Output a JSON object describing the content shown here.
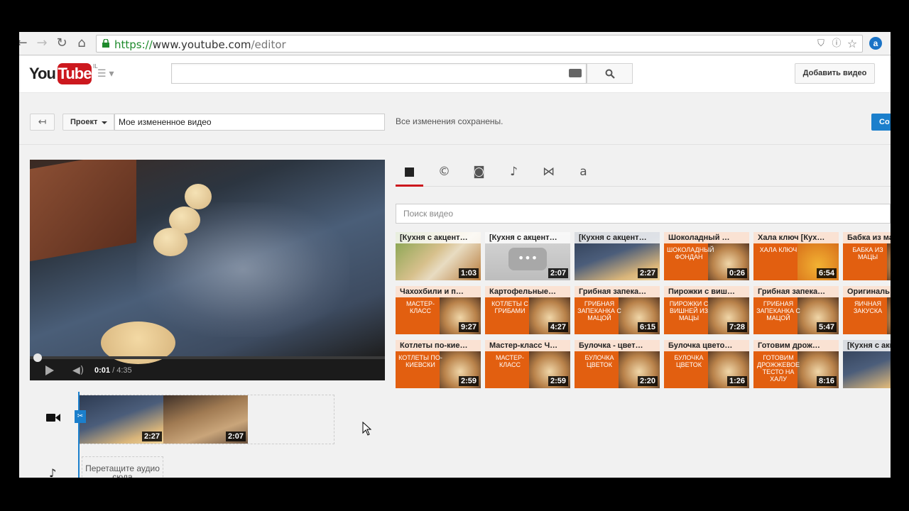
{
  "browser": {
    "url_scheme": "https://",
    "url_host": "www.youtube.com",
    "url_path": "/editor",
    "ext_label": "a"
  },
  "header": {
    "logo_you": "You",
    "logo_tube": "Tube",
    "logo_region": "IL",
    "search_placeholder": "",
    "upload_label": "Добавить видео"
  },
  "project": {
    "back_label": "↤",
    "menu_label": "Проект",
    "title_value": "Мое измененное видео",
    "saved_status": "Все изменения сохранены.",
    "publish_label": "Со"
  },
  "player": {
    "current_time": "0:01",
    "total_time": " / 4:35",
    "progress_fraction": 0.004
  },
  "library": {
    "search_placeholder": "Поиск видео",
    "tabs": [
      {
        "name": "video-camera-icon",
        "glyph": "■"
      },
      {
        "name": "cc-icon",
        "glyph": "©"
      },
      {
        "name": "camera-icon",
        "glyph": "◙"
      },
      {
        "name": "music-icon",
        "glyph": "♪"
      },
      {
        "name": "transition-icon",
        "glyph": "⋈"
      },
      {
        "name": "text-icon",
        "glyph": "a"
      }
    ],
    "videos": [
      {
        "title": "[Кухня с акцент…",
        "duration": "1:03",
        "style": "photo1",
        "brand": ""
      },
      {
        "title": "[Кухня с акцент…",
        "duration": "2:07",
        "style": "grey",
        "brand": ""
      },
      {
        "title": "[Кухня с акцент…",
        "duration": "2:27",
        "style": "photo2",
        "brand": ""
      },
      {
        "title": "Шоколадный …",
        "duration": "0:26",
        "style": "orange",
        "brand": "шоколадный фондан"
      },
      {
        "title": "Хала ключ [Кух…",
        "duration": "6:54",
        "style": "orange2",
        "brand": "хала ключ"
      },
      {
        "title": "Бабка из ма…",
        "duration": "",
        "style": "orange",
        "brand": "бабка из мацы"
      },
      {
        "title": "Чахохбили и п…",
        "duration": "9:27",
        "style": "orange",
        "brand": "мастер-класс"
      },
      {
        "title": "Картофельные…",
        "duration": "4:27",
        "style": "orange",
        "brand": "котлеты с грибами"
      },
      {
        "title": "Грибная запека…",
        "duration": "6:15",
        "style": "orange",
        "brand": "грибная запеканка с мацой"
      },
      {
        "title": "Пирожки с виш…",
        "duration": "7:28",
        "style": "orange",
        "brand": "пирожки с вишней из мацы"
      },
      {
        "title": "Грибная запека…",
        "duration": "5:47",
        "style": "orange",
        "brand": "грибная запеканка с мацой"
      },
      {
        "title": "Оригиналь…",
        "duration": "",
        "style": "orange",
        "brand": "яичная закуска"
      },
      {
        "title": "Котлеты по-кие…",
        "duration": "2:59",
        "style": "orange",
        "brand": "котлеты по-киевски"
      },
      {
        "title": "Мастер-класс Ч…",
        "duration": "2:59",
        "style": "orange",
        "brand": "мастер-класс"
      },
      {
        "title": "Булочка - цвет…",
        "duration": "2:20",
        "style": "orange",
        "brand": "булочка цветок"
      },
      {
        "title": "Булочка цвето…",
        "duration": "1:26",
        "style": "orange",
        "brand": "булочка цветок"
      },
      {
        "title": "Готовим дрож…",
        "duration": "8:16",
        "style": "orange",
        "brand": "готовим дрожжевое тесто на халу"
      },
      {
        "title": "[Кухня с акц…",
        "duration": "",
        "style": "photo2",
        "brand": ""
      }
    ]
  },
  "timeline": {
    "clips": [
      {
        "duration": "2:27",
        "style": "photo2"
      },
      {
        "duration": "2:07",
        "style": "buns"
      }
    ],
    "audio_drop_label": "Перетащите аудио сюда"
  },
  "colors": {
    "brand_red": "#cc181e",
    "accent_blue": "#1b7fcc",
    "thumb_orange": "#e25f10"
  }
}
